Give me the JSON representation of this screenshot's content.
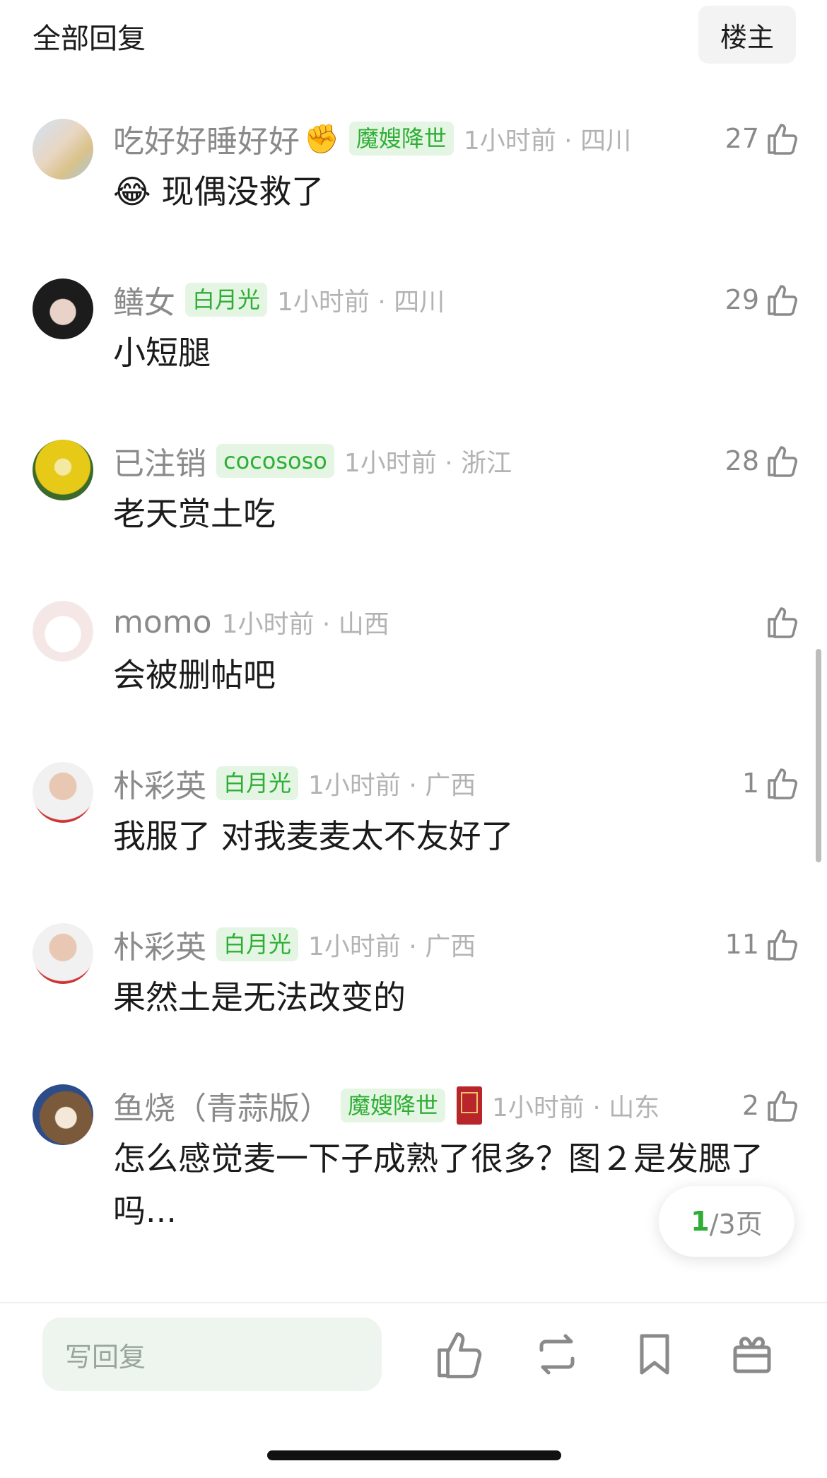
{
  "header": {
    "title": "全部回复",
    "op_button": "楼主"
  },
  "comments": [
    {
      "user": "吃好好睡好好",
      "emoji_suffix": "✊",
      "badge": "魔嫂降世",
      "time": "1小时前 · 四川",
      "likes": "27",
      "text": "😂 现偶没救了",
      "avatar_icon": "group-photo-avatar"
    },
    {
      "user": "鳝女",
      "badge": "白月光",
      "time": "1小时前 · 四川",
      "likes": "29",
      "text": "小短腿",
      "avatar_icon": "girl-portrait-avatar"
    },
    {
      "user": "已注销",
      "badge": "cocososo",
      "time": "1小时前 · 浙江",
      "likes": "28",
      "text": "老天赏土吃",
      "avatar_icon": "teletubby-avatar"
    },
    {
      "user": "momo",
      "badge": "",
      "time": "1小时前 · 山西",
      "likes": "",
      "text": "会被删帖吧",
      "avatar_icon": "cartoon-sheep-avatar"
    },
    {
      "user": "朴彩英",
      "badge": "白月光",
      "time": "1小时前 · 广西",
      "likes": "1",
      "text": "我服了 对我麦麦太不友好了",
      "avatar_icon": "man-selfie-avatar"
    },
    {
      "user": "朴彩英",
      "badge": "白月光",
      "time": "1小时前 · 广西",
      "likes": "11",
      "text": "果然土是无法改变的",
      "avatar_icon": "man-selfie-avatar"
    },
    {
      "user": "鱼烧（青蒜版）",
      "badge": "魔嫂降世",
      "time": "1小时前 · 山东",
      "likes": "2",
      "text": "怎么感觉麦一下子成熟了很多？图２是发腮了吗...",
      "avatar_icon": "cat-photo-avatar",
      "has_red_book": true
    }
  ],
  "pager": {
    "current": "1",
    "rest": "/3页"
  },
  "bottom_bar": {
    "reply_placeholder": "写回复",
    "icons": [
      "thumbs-up-icon",
      "repost-icon",
      "bookmark-icon",
      "gift-icon"
    ]
  },
  "colors": {
    "badge_bg": "#e4f6e3",
    "badge_text": "#2fae36",
    "meta_gray": "#8a8a8a",
    "time_gray": "#b3b3b3"
  }
}
